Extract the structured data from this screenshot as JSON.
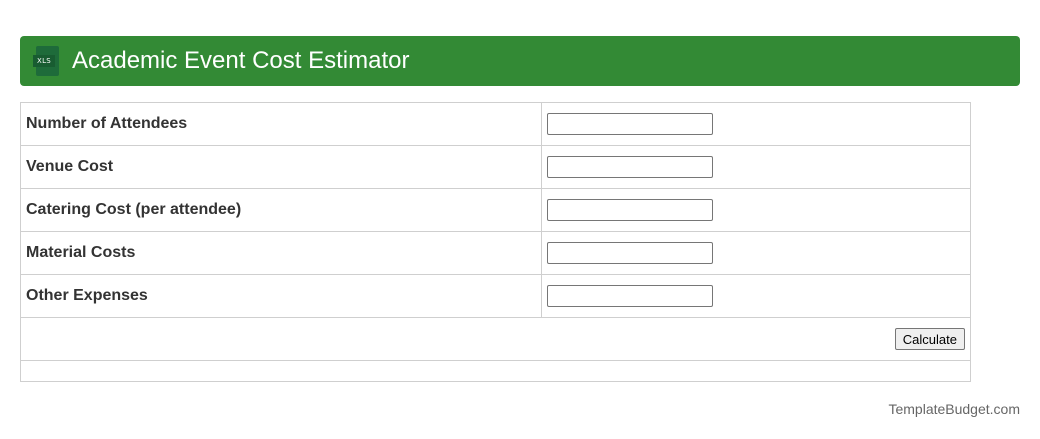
{
  "header": {
    "title": "Academic Event Cost Estimator",
    "icon": "xls-file-icon",
    "icon_text": "XLS",
    "accent_color": "#338a35"
  },
  "form": {
    "fields": [
      {
        "label": "Number of Attendees",
        "value": ""
      },
      {
        "label": "Venue Cost",
        "value": ""
      },
      {
        "label": "Catering Cost (per attendee)",
        "value": ""
      },
      {
        "label": "Material Costs",
        "value": ""
      },
      {
        "label": "Other Expenses",
        "value": ""
      }
    ],
    "calculate_label": "Calculate",
    "result": ""
  },
  "footer": {
    "brand": "TemplateBudget.com"
  }
}
